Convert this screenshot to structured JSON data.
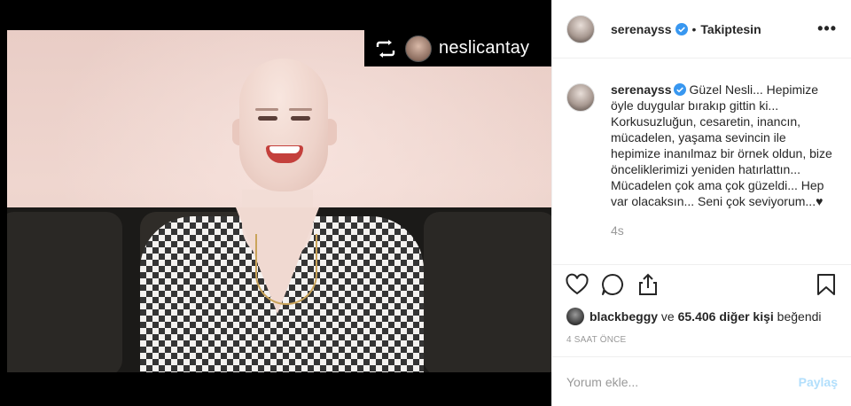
{
  "media": {
    "repost_name": "neslicantay"
  },
  "post": {
    "username": "serenayss",
    "separator": "•",
    "follow_status": "Takiptesin",
    "more_label": "•••",
    "caption_username": "serenayss",
    "caption_text": "Güzel Nesli... Hepimize öyle duygular bırakıp gittin ki... Korkusuzluğun, cesaretin, inancın, mücadelen, yaşama sevincin ile hepimize inanılmaz bir örnek oldun, bize önceliklerimizi yeniden hatırlattın... Mücadelen çok ama çok güzeldi... Hep var olacaksın... Seni çok seviyorum...♥",
    "caption_time": "4s",
    "likes_user": "blackbeggy",
    "likes_mid": " ve ",
    "likes_count": "65.406 diğer kişi",
    "likes_suffix": " beğendi",
    "posted_ago": "4 SAAT ÖNCE"
  },
  "comment": {
    "placeholder": "Yorum ekle...",
    "share_label": "Paylaş"
  },
  "colors": {
    "accent": "#3897f0",
    "share_disabled": "#b2dffc",
    "muted": "#999999",
    "text": "#262626"
  },
  "icons": [
    "repost-icon",
    "verified-icon",
    "heart-icon",
    "comment-icon",
    "share-icon",
    "bookmark-icon"
  ]
}
